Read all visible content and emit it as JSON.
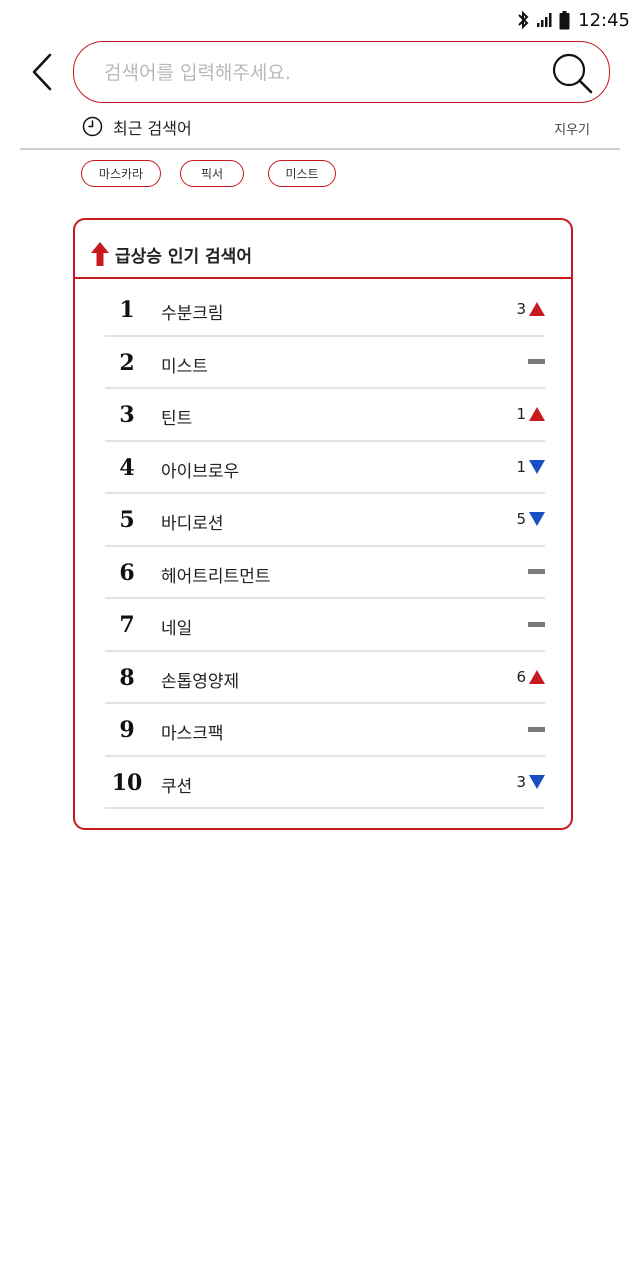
{
  "status_bar": {
    "time": "12:45"
  },
  "search": {
    "placeholder": "검색어를 입력해주세요.",
    "value": ""
  },
  "recent": {
    "label": "최근 검색어",
    "clear_label": "지우기",
    "chips": [
      "마스카라",
      "픽서",
      "미스트"
    ]
  },
  "trending": {
    "title": "급상승 인기 검색어",
    "items": [
      {
        "rank": "1",
        "term": "수분크림",
        "change": "3",
        "direction": "up"
      },
      {
        "rank": "2",
        "term": "미스트",
        "change": "",
        "direction": "same"
      },
      {
        "rank": "3",
        "term": "틴트",
        "change": "1",
        "direction": "up"
      },
      {
        "rank": "4",
        "term": "아이브로우",
        "change": "1",
        "direction": "down"
      },
      {
        "rank": "5",
        "term": "바디로션",
        "change": "5",
        "direction": "down"
      },
      {
        "rank": "6",
        "term": "헤어트리트먼트",
        "change": "",
        "direction": "same"
      },
      {
        "rank": "7",
        "term": "네일",
        "change": "",
        "direction": "same"
      },
      {
        "rank": "8",
        "term": "손톱영양제",
        "change": "6",
        "direction": "up"
      },
      {
        "rank": "9",
        "term": "마스크팩",
        "change": "",
        "direction": "same"
      },
      {
        "rank": "10",
        "term": "쿠션",
        "change": "3",
        "direction": "down"
      }
    ]
  },
  "colors": {
    "accent": "#c8191f",
    "up": "#c8191f",
    "down": "#1a4fc4",
    "same": "#7a7a7a"
  },
  "icons": {
    "back": "chevron-left-icon",
    "search": "search-icon",
    "clock": "clock-icon",
    "trend": "arrow-up-icon",
    "up": "triangle-up-icon",
    "down": "triangle-down-icon",
    "same": "dash-icon"
  }
}
